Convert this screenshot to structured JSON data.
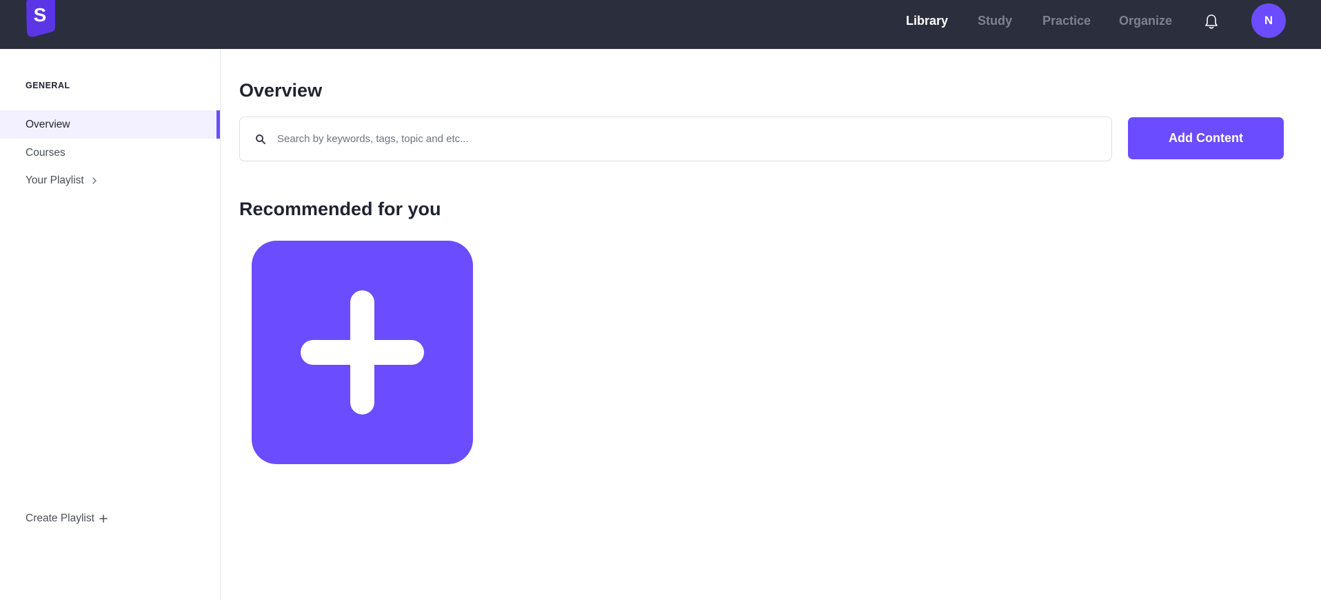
{
  "colors": {
    "topbar_bg": "#2b2f3d",
    "accent": "#6b4dff",
    "nav_inactive": "#7d8190",
    "nav_active": "#ffffff",
    "sidebar_active_bg": "#f3f1ff"
  },
  "header": {
    "logo_letter": "S",
    "nav": [
      {
        "label": "Library",
        "active": true
      },
      {
        "label": "Study",
        "active": false
      },
      {
        "label": "Practice",
        "active": false
      },
      {
        "label": "Organize",
        "active": false
      }
    ],
    "notifications_icon": "bell-icon",
    "avatar_initial": "N"
  },
  "sidebar": {
    "heading": "GENERAL",
    "items": [
      {
        "label": "Overview",
        "active": true
      },
      {
        "label": "Courses",
        "active": false
      },
      {
        "label": "Your Playlist",
        "active": false,
        "icon": "chevron-right-icon"
      }
    ],
    "create_playlist": {
      "label": "Create Playlist",
      "icon": "plus-icon"
    }
  },
  "main": {
    "title": "Overview",
    "search": {
      "placeholder": "Search by keywords, tags, topic and etc...",
      "value": "",
      "icon": "search-icon"
    },
    "add_button": "Add Content",
    "recommended_title": "Recommended for you",
    "add_tile_icon": "plus-icon"
  }
}
